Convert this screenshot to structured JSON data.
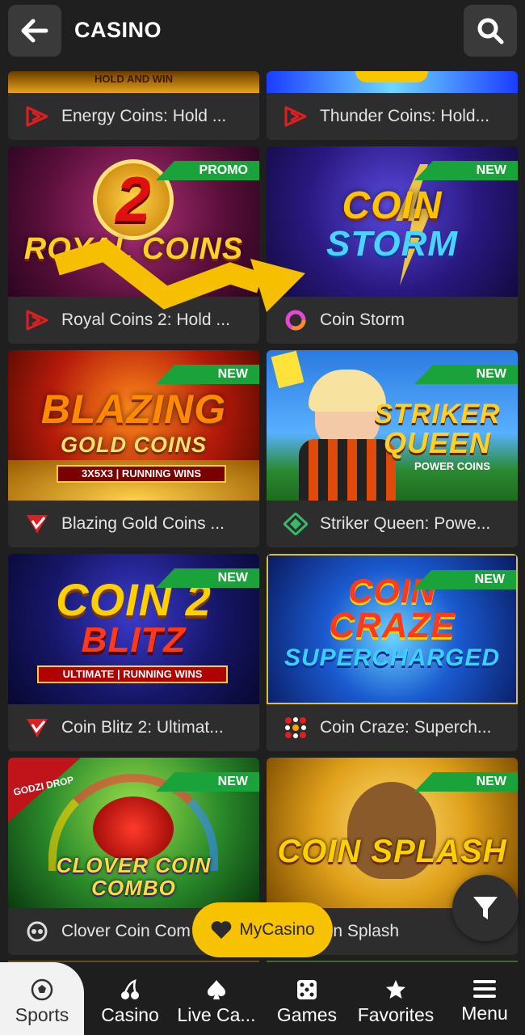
{
  "header": {
    "title": "CASINO"
  },
  "top_row": [
    {
      "banner": "HOLD AND WIN",
      "name": "Energy Coins: Hold ..."
    },
    {
      "name": "Thunder Coins: Hold..."
    }
  ],
  "games": [
    {
      "title_line1": "2",
      "title_line2": "ROYAL COINS",
      "name": "Royal Coins 2: Hold ...",
      "badge": "PROMO"
    },
    {
      "title_line1": "COIN",
      "title_line2": "STORM",
      "name": "Coin Storm",
      "badge": "NEW"
    },
    {
      "title_line1": "BLAZING",
      "title_line2": "GOLD COINS",
      "sub": "3X5X3 | RUNNING WINS",
      "name": "Blazing Gold Coins ...",
      "badge": "NEW"
    },
    {
      "title_line1": "STRIKER",
      "title_line2": "QUEEN",
      "sub": "POWER COINS",
      "name": "Striker Queen: Powe...",
      "badge": "NEW"
    },
    {
      "title_line1": "COIN 2",
      "title_line2": "BLITZ",
      "sub": "ULTIMATE | RUNNING WINS",
      "name": "Coin Blitz 2: Ultimat...",
      "badge": "NEW"
    },
    {
      "title_line1": "COIN",
      "title_line2": "CRAZE",
      "sub": "SUPERCHARGED",
      "name": "Coin Craze: Superch...",
      "badge": "NEW"
    },
    {
      "title_line1": "CLOVER COIN",
      "title_line2": "COMBO",
      "sub": "GODZI DROP",
      "name": "Clover Coin Com",
      "badge": "NEW"
    },
    {
      "title_line1": "COIN SPLASH",
      "title_line2": "",
      "name": "oin Splash",
      "badge": "NEW"
    }
  ],
  "floating": {
    "mycasino": "MyCasino"
  },
  "nav": [
    {
      "label": "Sports",
      "icon": "soccer-ball-icon"
    },
    {
      "label": "Casino",
      "icon": "cherries-icon"
    },
    {
      "label": "Live Ca...",
      "icon": "spade-icon"
    },
    {
      "label": "Games",
      "icon": "dice-icon"
    },
    {
      "label": "Favorites",
      "icon": "star-icon"
    },
    {
      "label": "Menu",
      "icon": "hamburger-menu-icon"
    }
  ],
  "colors": {
    "badge_green": "#1aa33a",
    "accent_yellow": "#f7c200",
    "card_bg": "#2d2d2d"
  }
}
